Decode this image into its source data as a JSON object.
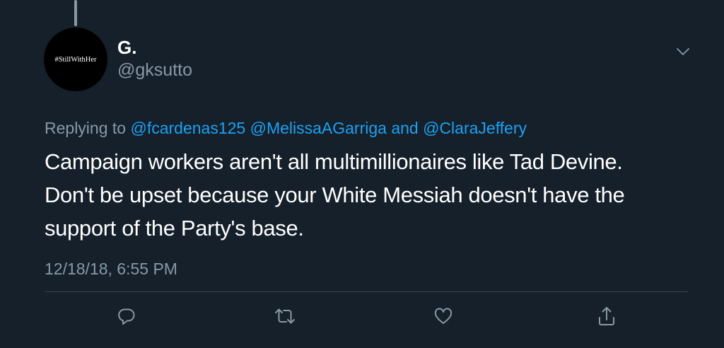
{
  "tweet": {
    "author": {
      "display_name": "G.",
      "handle": "@gksutto",
      "avatar_text": "#StillWithHer"
    },
    "reply_context": {
      "prefix": "Replying to",
      "mentions": [
        "@fcardenas125",
        "@MelissaAGarriga"
      ],
      "conjunction": "and",
      "last_mention": "@ClaraJeffery"
    },
    "text_lines": [
      "Campaign workers aren't all multimillionaires like Tad Devine.",
      "Don't be upset because your White Messiah doesn't have the",
      "support of the Party's base."
    ],
    "timestamp": "12/18/18, 6:55 PM"
  },
  "actions": [
    {
      "name": "reply",
      "icon": "reply-icon"
    },
    {
      "name": "retweet",
      "icon": "retweet-icon"
    },
    {
      "name": "like",
      "icon": "heart-icon"
    },
    {
      "name": "share",
      "icon": "share-icon"
    }
  ],
  "colors": {
    "background": "#15202b",
    "text": "#ffffff",
    "secondary_text": "#8899a6",
    "link": "#1da1f2",
    "divider": "#38444d"
  }
}
